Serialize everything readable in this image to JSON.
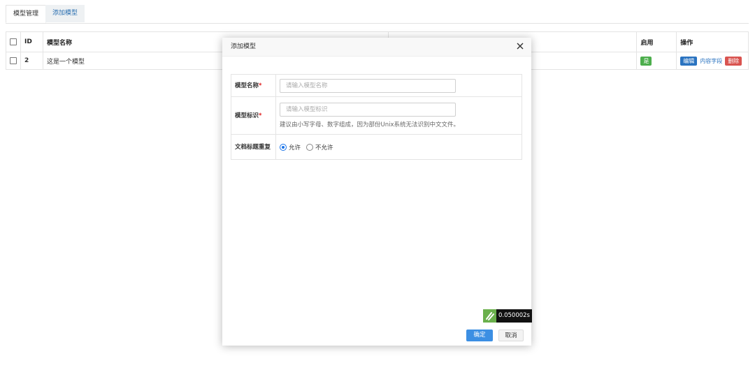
{
  "tabs": [
    "模型管理",
    "添加模型"
  ],
  "table": {
    "headers": {
      "id": "ID",
      "name": "模型名称",
      "enabled": "启用",
      "actions": "操作"
    },
    "rows": [
      {
        "id": "2",
        "name": "这是一个模型",
        "enabled": "是",
        "edit": "编辑",
        "fields": "内容字段",
        "delete": "删除"
      }
    ]
  },
  "modal": {
    "title": "添加模型",
    "fields": {
      "name": {
        "label": "模型名称",
        "required": "*",
        "placeholder": "请输入模型名称"
      },
      "identifier": {
        "label": "模型标识",
        "required": "*",
        "placeholder": "请输入模型标识",
        "hint": "建议由小写字母、数字组成，因为部份Unix系统无法识别中文文件。"
      },
      "duplicate": {
        "label": "文档标题重复",
        "options": [
          "允许",
          "不允许"
        ],
        "selected": "允许"
      }
    },
    "timer": "0.050002s",
    "ok": "确定",
    "cancel": "取消"
  },
  "colors": {
    "accent": "#3c8fe3",
    "success": "#4cae4c",
    "danger": "#d9534f",
    "primary": "#2a73c0"
  }
}
